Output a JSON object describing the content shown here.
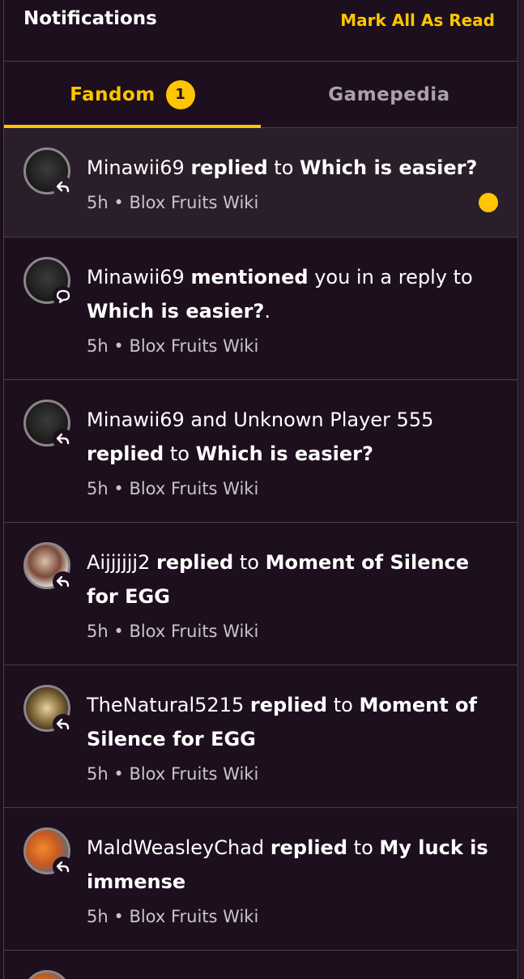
{
  "header": {
    "title": "Notifications",
    "mark_all_label": "Mark All As Read"
  },
  "tabs": [
    {
      "label": "Fandom",
      "badge": "1",
      "active": true
    },
    {
      "label": "Gamepedia",
      "active": false
    }
  ],
  "colors": {
    "accent": "#ffc500",
    "background": "#1d0f1d",
    "unread_background": "#2a1e2a",
    "divider": "#4a3f48"
  },
  "notifications": [
    {
      "unread": true,
      "icon": "reply-icon",
      "user": "Minawii69",
      "action": "replied",
      "connector": "to",
      "target": "Which is easier?",
      "time": "5h",
      "separator": "•",
      "wiki": "Blox Fruits Wiki"
    },
    {
      "unread": false,
      "icon": "mention-icon",
      "user": "Minawii69",
      "action": "mentioned",
      "connector": "you in a reply to",
      "target": "Which is easier?",
      "suffix": ".",
      "time": "5h",
      "separator": "•",
      "wiki": "Blox Fruits Wiki"
    },
    {
      "unread": false,
      "icon": "reply-icon",
      "user": "Minawii69 and Unknown Player 555",
      "action": "replied",
      "connector": "to",
      "target": "Which is easier?",
      "time": "5h",
      "separator": "•",
      "wiki": "Blox Fruits Wiki"
    },
    {
      "unread": false,
      "icon": "reply-icon",
      "user": "Aijjjjjj2",
      "action": "replied",
      "connector": "to",
      "target": "Moment of Silence for EGG",
      "time": "5h",
      "separator": "•",
      "wiki": "Blox Fruits Wiki"
    },
    {
      "unread": false,
      "icon": "reply-icon",
      "user": "TheNatural5215",
      "action": "replied",
      "connector": "to",
      "target": "Moment of Silence for EGG",
      "time": "5h",
      "separator": "•",
      "wiki": "Blox Fruits Wiki"
    },
    {
      "unread": false,
      "icon": "reply-icon",
      "user": "MaldWeasleyChad",
      "action": "replied",
      "connector": "to",
      "target": "My luck is immense",
      "time": "5h",
      "separator": "•",
      "wiki": "Blox Fruits Wiki"
    }
  ]
}
